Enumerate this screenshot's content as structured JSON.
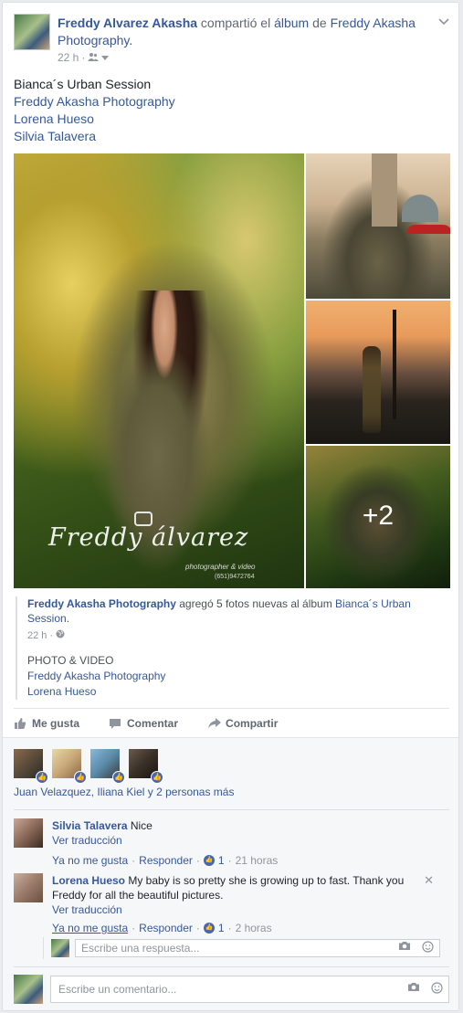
{
  "header": {
    "author": "Freddy Alvarez Akasha",
    "action_text": " compartió el ",
    "album_word": "álbum",
    "of_text": " de ",
    "page_name": "Freddy Akasha Photography.",
    "time": "22 h",
    "dot": "·",
    "audience_icon": "friends-icon",
    "dropdown_icon": "chevron-down-icon"
  },
  "post": {
    "lines": [
      "Bianca´s Urban Session",
      "Freddy Akasha Photography",
      "Lorena Hueso",
      "Silvia Talavera"
    ]
  },
  "photos": {
    "watermark": "Freddy álvarez",
    "watermark_sub": "photographer & video",
    "watermark_phone": "(651)9472764",
    "more_count": "+2"
  },
  "attachment": {
    "page": "Freddy Akasha Photography",
    "mid": " agregó 5 fotos nuevas al álbum ",
    "album": "Bianca´s Urban Session",
    "end": ".",
    "time": "22 h",
    "dot": "·",
    "globe_icon": "globe-icon",
    "category": "PHOTO & VIDEO",
    "link1": "Freddy Akasha Photography",
    "link2": "Lorena Hueso"
  },
  "actions": {
    "like": "Me gusta",
    "comment": "Comentar",
    "share": "Compartir"
  },
  "likers": {
    "text": "Juan Velazquez, Iliana Kiel y 2 personas más"
  },
  "comments": [
    {
      "name": "Silvia Talavera",
      "text": " Nice",
      "translate": "Ver traducción",
      "unlike": "Ya no me gusta",
      "dot1": "·",
      "reply": "Responder",
      "dot2": "·",
      "likes": "1",
      "dot3": "·",
      "time": "21 horas"
    },
    {
      "name": "Lorena Hueso",
      "text": " My baby is so pretty she is growing up to fast. Thank you Freddy for all the beautiful pictures.",
      "translate": "Ver traducción",
      "unlike": "Ya no me gusta",
      "dot1": "·",
      "reply": "Responder",
      "dot2": "·",
      "likes": "1",
      "dot3": "·",
      "time": "2 horas",
      "close": "✕"
    }
  ],
  "reply_input": {
    "placeholder": "Escribe una respuesta..."
  },
  "comment_input": {
    "placeholder": "Escribe un comentario..."
  },
  "colors": {
    "link": "#365899",
    "meta": "#90949c",
    "like_blue": "#4267b2",
    "ufi_bg": "#f6f7f9"
  }
}
